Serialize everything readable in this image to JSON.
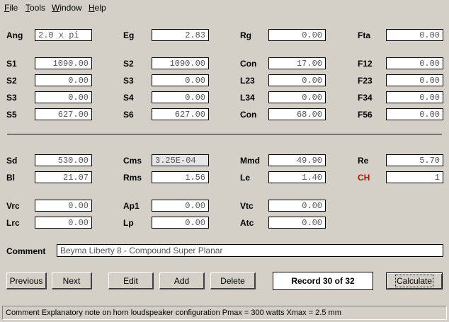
{
  "menu": [
    {
      "first": "F",
      "rest": "ile"
    },
    {
      "first": "T",
      "rest": "ools"
    },
    {
      "first": "W",
      "rest": "indow"
    },
    {
      "first": "H",
      "rest": "elp"
    }
  ],
  "params": {
    "Ang": "2.0 x pi",
    "Eg": "2.83",
    "Rg": "0.00",
    "Fta": "0.00",
    "S1": "1090.00",
    "S2b": "1090.00",
    "Con1": "17.00",
    "F12": "0.00",
    "S2": "0.00",
    "S3b": "0.00",
    "L23": "0.00",
    "F23": "0.00",
    "S3": "0.00",
    "S4": "0.00",
    "L34": "0.00",
    "F34": "0.00",
    "S5": "627.00",
    "S6": "627.00",
    "Con2": "68.00",
    "F56": "0.00",
    "Sd": "530.00",
    "Cms": "3.25E-04",
    "Mmd": "49.90",
    "Re": "5.70",
    "Bl": "21.07",
    "Rms": "1.56",
    "Le": "1.40",
    "CH": "1",
    "Vrc": "0.00",
    "Ap1": "0.00",
    "Vtc": "0.00",
    "Lrc": "0.00",
    "Lp": "0.00",
    "Atc": "0.00"
  },
  "labels": {
    "Ang": "Ang",
    "Eg": "Eg",
    "Rg": "Rg",
    "Fta": "Fta",
    "S1": "S1",
    "S2b": "S2",
    "Con1": "Con",
    "F12": "F12",
    "S2": "S2",
    "S3b": "S3",
    "L23": "L23",
    "F23": "F23",
    "S3": "S3",
    "S4": "S4",
    "L34": "L34",
    "F34": "F34",
    "S5": "S5",
    "S6": "S6",
    "Con2": "Con",
    "F56": "F56",
    "Sd": "Sd",
    "Cms": "Cms",
    "Mmd": "Mmd",
    "Re": "Re",
    "Bl": "Bl",
    "Rms": "Rms",
    "Le": "Le",
    "CH": "CH",
    "Vrc": "Vrc",
    "Ap1": "Ap1",
    "Vtc": "Vtc",
    "Lrc": "Lrc",
    "Lp": "Lp",
    "Atc": "Atc",
    "Comment": "Comment"
  },
  "comment": "Beyma Liberty 8 - Compound Super Planar",
  "buttons": {
    "previous": "Previous",
    "next": "Next",
    "edit": "Edit",
    "add": "Add",
    "delete": "Delete",
    "calculate": "Calculate"
  },
  "record": "Record 30 of 32",
  "status": "Comment   Explanatory note on horn loudspeaker configuration   Pmax = 300 watts   Xmax = 2.5 mm",
  "colors": {
    "ch_label": "#d40000"
  }
}
